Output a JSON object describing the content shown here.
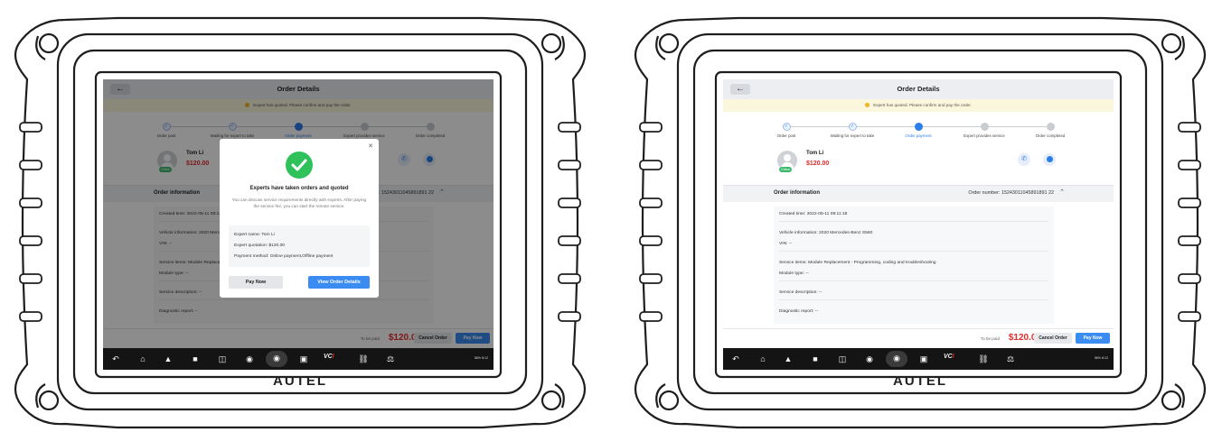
{
  "brand": "AUTEL",
  "screen": {
    "title": "Order Details",
    "notice": "Expert has quoted. Please confirm and pay the order.",
    "steps": [
      {
        "label": "Order post",
        "state": "done"
      },
      {
        "label": "Waiting for expert to take",
        "state": "done"
      },
      {
        "label": "Order payment",
        "state": "active"
      },
      {
        "label": "Expert provides service",
        "state": "todo"
      },
      {
        "label": "Order completed",
        "state": "todo"
      }
    ],
    "expert": {
      "name": "Tom Li",
      "price": "$120.00",
      "status": "Online"
    },
    "order": {
      "section_label": "Order information",
      "number": "Order number: 15243011045891891 22",
      "created": "Created time: 2022-05-11 08:11:18",
      "vehicle": "Vehicle information: 2020 Mercedes-Benz S560",
      "vin": "VIN: --",
      "service_items": "Service items: Module Replacement - Programming, coding and troubleshooting",
      "module_type": "Module type: --",
      "service_description": "Service description: --",
      "diagnostic_report": "Diagnostic report: --"
    },
    "bottom": {
      "to_be_paid_label": "To be paid",
      "amount": "$120.00",
      "cancel_label": "Cancel Order",
      "pay_label": "Pay Now"
    },
    "status_text": "56% 8:12"
  },
  "modal": {
    "title": "Experts have taken orders and quoted",
    "description": "You can discuss service requirements directly with experts. After paying the service fee, you can start the remote service.",
    "expert_name": "Expert name: Tom Li",
    "expert_quotation": "Expert quotation: $120.00",
    "payment_method": "Payment method: Online payment,Offline payment",
    "pay_label": "Pay Now",
    "view_label": "View Order Details"
  },
  "colors": {
    "accent": "#3a8bf2",
    "price": "#e32a2a",
    "notice_bg": "#fbf7dc",
    "success": "#2fc25b",
    "navbar": "#141414"
  },
  "icons": [
    "back-arrow-icon",
    "phone-icon",
    "chat-icon",
    "close-icon",
    "check-icon",
    "chevron-up-icon",
    "nav-back-icon",
    "nav-home-icon",
    "nav-house-icon",
    "nav-recent-icon",
    "nav-split-icon",
    "nav-browser-icon",
    "nav-camera-icon",
    "nav-screen-record-icon",
    "nav-vci-icon",
    "nav-car-icon",
    "nav-garage-icon"
  ]
}
